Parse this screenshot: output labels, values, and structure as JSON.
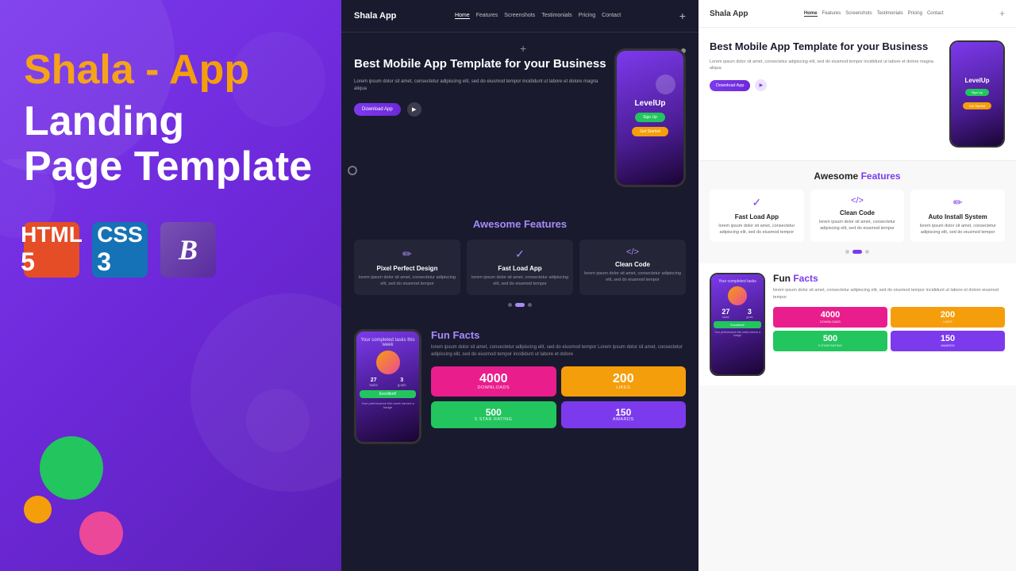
{
  "left": {
    "title_line1": "Shala - App",
    "title_line2": "Landing",
    "title_line3": "Page Template",
    "icons": [
      {
        "name": "HTML5",
        "symbol": "5",
        "type": "html"
      },
      {
        "name": "CSS3",
        "symbol": "3",
        "type": "css"
      },
      {
        "name": "Bootstrap",
        "symbol": "B",
        "type": "bootstrap"
      }
    ]
  },
  "preview_dark": {
    "navbar": {
      "logo": "Shala App",
      "links": [
        "Home",
        "Features",
        "Screenshots",
        "Testimonials",
        "Pricing",
        "Contact"
      ],
      "plus": "+"
    },
    "hero": {
      "title": "Best Mobile App Template for your Business",
      "description": "Lorem ipsum dolor sit amet, consectetur adipiscing elit, sed do eiusmod tempor incididunt ut labore et dolore magna aliqua",
      "btn_download": "Download App",
      "plus_deco": "+"
    },
    "features": {
      "heading": "Awesome",
      "heading_accent": "Features",
      "items": [
        {
          "icon": "✏",
          "name": "Pixel Perfect Design",
          "desc": "lorem ipsum dolor sit amet, consectetur adipiscing elit, sed do eiusmod tempor"
        },
        {
          "icon": "✓",
          "name": "Fast Load App",
          "desc": "lorem ipsum dolor sit amet, consectetur adipiscing elit, sed do eiusmod tempor"
        },
        {
          "icon": "</>",
          "name": "Clean Code",
          "desc": "lorem ipsum dolor sit amet, consectetur adipiscing elit, sed do eiusmod tempor"
        }
      ]
    },
    "fun_facts": {
      "heading": "Fun",
      "heading_accent": "Facts",
      "description": "lorem ipsum dolor sit amet, consectetur adipiscing elit, sed do eiusmod tempor Lorem ipsum dolor sit amet, consectetur adipiscing elit, sed do eiusmod tempor incididunt ut labore et dolore",
      "stats": [
        {
          "number": "4000",
          "label": "DOWNLOADS",
          "color": "pink"
        },
        {
          "number": "200",
          "label": "LIKES",
          "color": "orange"
        },
        {
          "number": "500",
          "label": "5 STAR RATING",
          "color": "green"
        },
        {
          "number": "150",
          "label": "AWARDS",
          "color": "purple"
        }
      ],
      "phone": {
        "task_label": "Your completed tasks this week",
        "stat1": "27",
        "stat2": "3",
        "badge": "Excellent!",
        "performance_label": "Your performance this week earned a badge"
      }
    }
  },
  "preview_light": {
    "navbar": {
      "logo": "Shala App",
      "links": [
        "Home",
        "Features",
        "Screenshots",
        "Testimonials",
        "Pricing",
        "Contact"
      ],
      "plus": "+"
    },
    "hero": {
      "title": "Best Mobile App Template for your Business",
      "description": "Lorem ipsum dolor sit amet, consectetur adipiscing elit, sed do eiusmod tempor incididunt ut labore et dolore magna aliqua"
    },
    "features": {
      "heading": "Awesome",
      "heading_accent": "Features",
      "items": [
        {
          "icon": "✓",
          "name": "Fast Load App",
          "desc": "lorem ipsum dolor sit amet, consectetur adipiscing elit, sed do eiusmod tempor"
        },
        {
          "icon": "</>",
          "name": "Clean Code",
          "desc": "lorem ipsum dolor sit amet, consectetur adipiscing elit, sed do eiusmod tempor"
        },
        {
          "icon": "✏",
          "name": "Auto Install System",
          "desc": "lorem ipsum dolor sit amet, consectetur adipiscing elit, sed do eiusmod tempor"
        }
      ]
    },
    "fun_facts": {
      "heading": "Fun",
      "heading_accent": "Facts",
      "description": "lorem ipsum dolor sit amet, consectetur adipiscing elit, sed do eiusmod tempor incididunt ut labore et dolore eiusmod tempor",
      "stats": [
        {
          "number": "4000",
          "label": "DOWNLOADS",
          "color": "pink"
        },
        {
          "number": "200",
          "label": "LIKES",
          "color": "orange"
        },
        {
          "number": "500",
          "label": "5 STAR RATING",
          "color": "green"
        },
        {
          "number": "150",
          "label": "AWARDS",
          "color": "purple"
        }
      ]
    }
  }
}
